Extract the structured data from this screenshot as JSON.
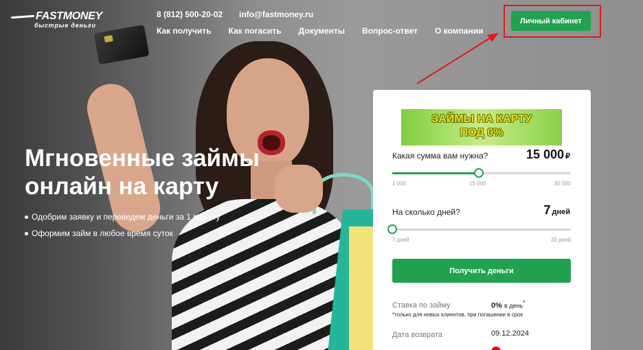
{
  "header": {
    "logo_name": "FASTMONEY",
    "logo_tagline": "быстрые деньги",
    "phone": "8 (812) 500-20-02",
    "email": "info@fastmoney.ru",
    "nav": [
      "Как получить",
      "Как погасить",
      "Документы",
      "Вопрос-ответ",
      "О компании"
    ],
    "cabinet_button": "Личный кабинет"
  },
  "hero": {
    "title_line1": "Мгновенные займы",
    "title_line2": "онлайн на карту",
    "bullets": [
      "Одобрим заявку и переведем деньги за 1 минуту",
      "Оформим займ в любое время суток"
    ]
  },
  "calculator": {
    "promo_line1": "ЗАЙМЫ НА КАРТУ",
    "promo_line2": "ПОД 0%",
    "amount": {
      "label": "Какая сумма вам нужна?",
      "value": "15 000",
      "unit": "₽",
      "min": 1000,
      "max": 30000,
      "current": 15000,
      "ticks": [
        "1 000",
        "15 000",
        "30 000"
      ]
    },
    "days": {
      "label": "На сколько дней?",
      "value": "7",
      "unit": "дней",
      "min": 7,
      "max": 30,
      "current": 7,
      "ticks": [
        "7 дней",
        "30 дней"
      ]
    },
    "submit_button": "Получить деньги",
    "rate_label": "Ставка по займу",
    "rate_value": "0%",
    "rate_suffix": "в день",
    "rate_mark": "*",
    "rate_note": "*только для новых клиентов, при погашении в срок",
    "return_label": "Дата возврата",
    "return_date": "09.12.2024"
  },
  "colors": {
    "accent_green": "#22a251",
    "highlight_red": "#e01a1a"
  }
}
